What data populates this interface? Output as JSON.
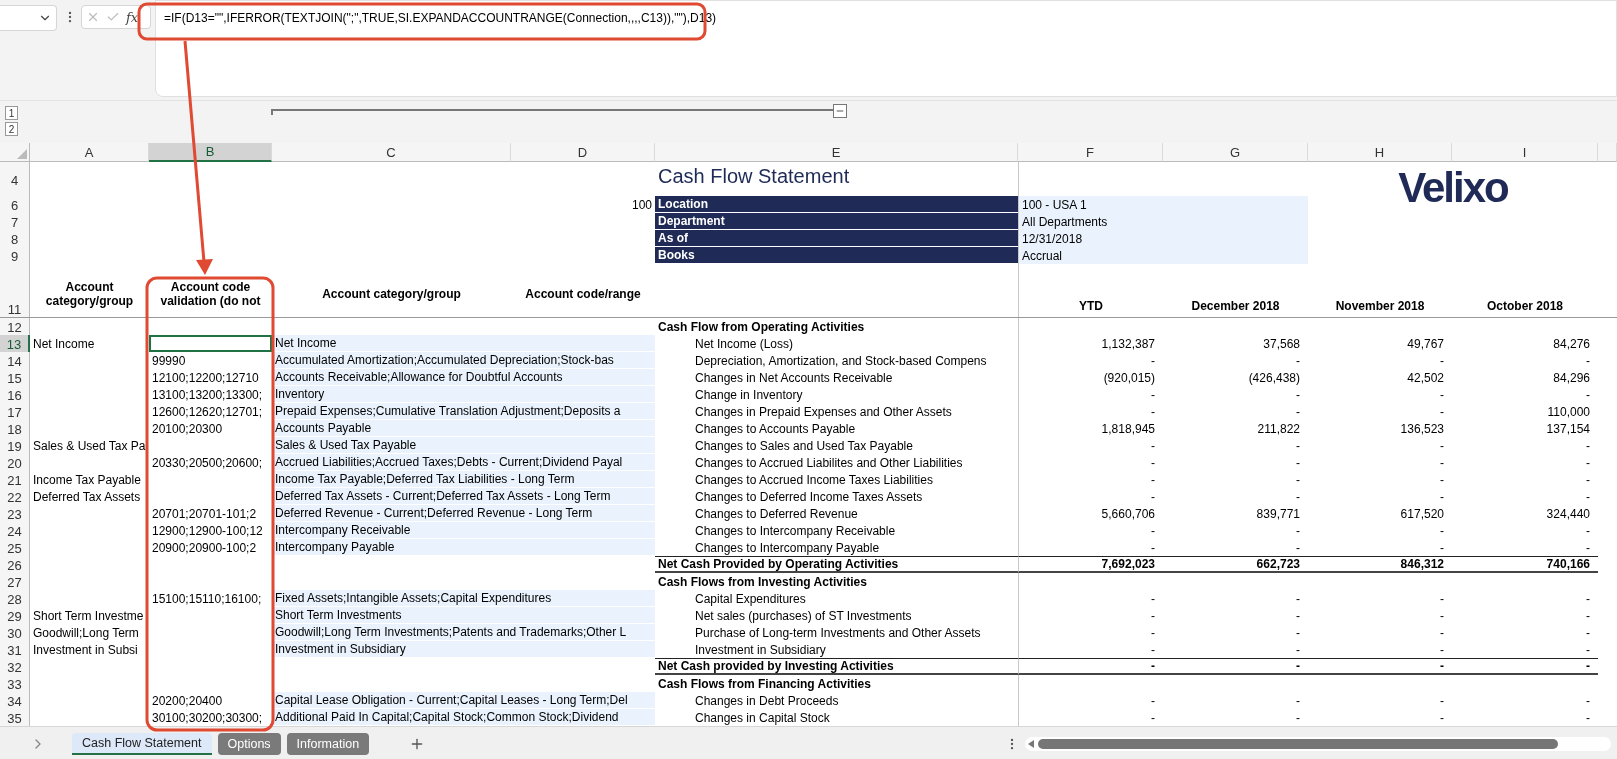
{
  "formula_bar": {
    "function_label": "fx",
    "formula": "=IF(D13=\"\",IFERROR(TEXTJOIN(\";\",TRUE,SI.EXPANDACCOUNTRANGE(Connection,,,,C13)),\"\"),D13)"
  },
  "outline_levels": [
    "1",
    "2"
  ],
  "columns": [
    {
      "letter": "A",
      "selected": false
    },
    {
      "letter": "B",
      "selected": true
    },
    {
      "letter": "C",
      "selected": false
    },
    {
      "letter": "D",
      "selected": false
    },
    {
      "letter": "E",
      "selected": false
    },
    {
      "letter": "F",
      "selected": false
    },
    {
      "letter": "G",
      "selected": false
    },
    {
      "letter": "H",
      "selected": false
    },
    {
      "letter": "I",
      "selected": false
    }
  ],
  "report": {
    "title_row": "4",
    "title": "Cash Flow Statement",
    "logo": "Velixo",
    "filters": [
      {
        "row": "6",
        "code": "100",
        "label": "Location",
        "value": "100 - USA 1"
      },
      {
        "row": "7",
        "label": "Department",
        "value": "All Departments"
      },
      {
        "row": "8",
        "label": "As of",
        "value": "12/31/2018"
      },
      {
        "row": "9",
        "label": "Books",
        "value": "Accrual"
      }
    ],
    "header_row": "11",
    "headers": {
      "col_a": "Account category/group",
      "col_b": "Account code validation (do not",
      "col_c": "Account category/group",
      "col_d": "Account code/range",
      "periods": [
        "YTD",
        "December 2018",
        "November 2018",
        "October 2018"
      ]
    }
  },
  "rows": [
    {
      "number": "12",
      "selected": false,
      "kind": "section",
      "label": "Cash Flow from Operating Activities"
    },
    {
      "number": "13",
      "selected": true,
      "kind": "item",
      "col_a": "Net Income",
      "col_c": "Net Income",
      "label": "Net Income (Loss)",
      "values": [
        "1,132,387",
        "37,568",
        "49,767",
        "84,276"
      ]
    },
    {
      "number": "14",
      "selected": false,
      "kind": "item",
      "col_b": "99990",
      "col_c": "Accumulated Amortization;Accumulated Depreciation;Stock-bas",
      "label": "Depreciation, Amortization, and Stock-based Compens",
      "values": [
        "-",
        "-",
        "-",
        "-"
      ]
    },
    {
      "number": "15",
      "selected": false,
      "kind": "item",
      "col_b": "12100;12200;12710",
      "col_c": "Accounts Receivable;Allowance for Doubtful Accounts",
      "label": "Changes in Net Accounts Receivable",
      "values": [
        "(920,015)",
        "(426,438)",
        "42,502",
        "84,296"
      ]
    },
    {
      "number": "16",
      "selected": false,
      "kind": "item",
      "col_b": "13100;13200;13300;",
      "col_c": "Inventory",
      "label": "Change in Inventory",
      "values": [
        "-",
        "-",
        "-",
        "-"
      ]
    },
    {
      "number": "17",
      "selected": false,
      "kind": "item",
      "col_b": "12600;12620;12701;",
      "col_c": "Prepaid Expenses;Cumulative Translation Adjustment;Deposits a",
      "label": "Changes in Prepaid Expenses and Other Assets",
      "values": [
        "-",
        "-",
        "-",
        "110,000"
      ]
    },
    {
      "number": "18",
      "selected": false,
      "kind": "item",
      "col_b": "20100;20300",
      "col_c": "Accounts Payable",
      "label": "Changes to Accounts Payable",
      "values": [
        "1,818,945",
        "211,822",
        "136,523",
        "137,154"
      ]
    },
    {
      "number": "19",
      "selected": false,
      "kind": "item",
      "col_a": "Sales & Used Tax Pa",
      "col_c": "Sales & Used Tax Payable",
      "label": "Changes to Sales and Used Tax Payable",
      "values": [
        "-",
        "-",
        "-",
        "-"
      ]
    },
    {
      "number": "20",
      "selected": false,
      "kind": "item",
      "col_b": "20330;20500;20600;",
      "col_c": "Accrued Liabilities;Accrued Taxes;Debts - Current;Dividend Payal",
      "label": "Changes to Accrued Liabilites and Other Liabilities",
      "values": [
        "-",
        "-",
        "-",
        "-"
      ]
    },
    {
      "number": "21",
      "selected": false,
      "kind": "item",
      "col_a": "Income Tax Payable",
      "col_c": "Income Tax Payable;Deferred Tax Liabilities - Long Term",
      "label": "Changes to Accrued Income Taxes Liabilities",
      "values": [
        "-",
        "-",
        "-",
        "-"
      ]
    },
    {
      "number": "22",
      "selected": false,
      "kind": "item",
      "col_a": "Deferred Tax Assets",
      "col_c": "Deferred Tax Assets - Current;Deferred Tax Assets - Long Term",
      "label": "Changes to Deferred Income Taxes Assets",
      "values": [
        "-",
        "-",
        "-",
        "-"
      ]
    },
    {
      "number": "23",
      "selected": false,
      "kind": "item",
      "col_b": "20701;20701-101;2",
      "col_c": "Deferred Revenue - Current;Deferred Revenue - Long Term",
      "label": "Changes to Deferred Revenue",
      "values": [
        "5,660,706",
        "839,771",
        "617,520",
        "324,440"
      ]
    },
    {
      "number": "24",
      "selected": false,
      "kind": "item",
      "col_b": "12900;12900-100;12",
      "col_c": "Intercompany Receivable",
      "label": "Changes to Intercompany Receivable",
      "values": [
        "-",
        "-",
        "-",
        "-"
      ]
    },
    {
      "number": "25",
      "selected": false,
      "kind": "item",
      "col_b": "20900;20900-100;2",
      "col_c": "Intercompany Payable",
      "label": "Changes to Intercompany Payable",
      "values": [
        "-",
        "-",
        "-",
        "-"
      ]
    },
    {
      "number": "26",
      "selected": false,
      "kind": "total",
      "label": "Net Cash Provided by Operating Activities",
      "values": [
        "7,692,023",
        "662,723",
        "846,312",
        "740,166"
      ]
    },
    {
      "number": "27",
      "selected": false,
      "kind": "section",
      "label": "Cash Flows from Investing Activities"
    },
    {
      "number": "28",
      "selected": false,
      "kind": "item",
      "col_b": "15100;15110;16100;",
      "col_c": "Fixed Assets;Intangible Assets;Capital Expenditures",
      "label": "Capital Expenditures",
      "values": [
        "-",
        "-",
        "-",
        "-"
      ]
    },
    {
      "number": "29",
      "selected": false,
      "kind": "item",
      "col_a": "Short Term Investme",
      "col_c": "Short Term Investments",
      "label": "Net sales (purchases) of ST Investments",
      "values": [
        "-",
        "-",
        "-",
        "-"
      ]
    },
    {
      "number": "30",
      "selected": false,
      "kind": "item",
      "col_a": "Goodwill;Long Term",
      "col_c": "Goodwill;Long Term Investments;Patents and Trademarks;Other L",
      "label": "Purchase of Long-term Investments and Other Assets",
      "values": [
        "-",
        "-",
        "-",
        "-"
      ]
    },
    {
      "number": "31",
      "selected": false,
      "kind": "item",
      "col_a": "Investment in Subsi",
      "col_c": "Investment in Subsidiary",
      "label": "Investment in Subsidiary",
      "values": [
        "-",
        "-",
        "-",
        "-"
      ]
    },
    {
      "number": "32",
      "selected": false,
      "kind": "total",
      "label": "Net Cash provided by Investing Activities",
      "values": [
        "-",
        "-",
        "-",
        "-"
      ]
    },
    {
      "number": "33",
      "selected": false,
      "kind": "section",
      "label": "Cash Flows from Financing Activities"
    },
    {
      "number": "34",
      "selected": false,
      "kind": "item",
      "col_b": "20200;20400",
      "col_c": "Capital Lease Obligation - Current;Capital Leases - Long Term;Del",
      "label": "Changes in Debt Proceeds",
      "values": [
        "-",
        "-",
        "-",
        "-"
      ]
    },
    {
      "number": "35",
      "selected": false,
      "kind": "item",
      "col_b": "30100;30200;30300;",
      "col_c": "Additional Paid In Capital;Capital Stock;Common Stock;Dividend",
      "label": "Changes in Capital Stock",
      "values": [
        "-",
        "-",
        "-",
        "-"
      ]
    }
  ],
  "sheet_tabs": [
    {
      "label": "Cash Flow Statement",
      "selected": true
    },
    {
      "label": "Options",
      "selected": false
    },
    {
      "label": "Information",
      "selected": false
    }
  ]
}
